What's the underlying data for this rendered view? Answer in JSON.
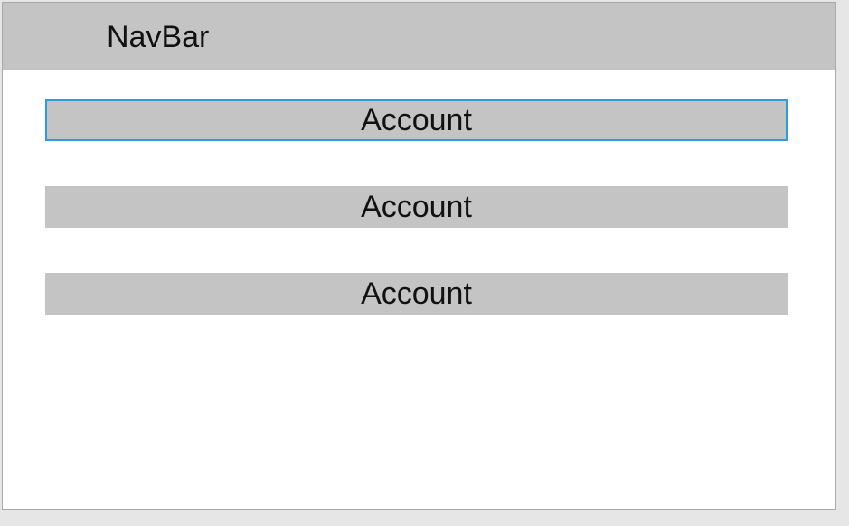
{
  "navbar": {
    "title": "NavBar"
  },
  "list": {
    "items": [
      {
        "label": "Account",
        "selected": true
      },
      {
        "label": "Account",
        "selected": false
      },
      {
        "label": "Account",
        "selected": false
      }
    ]
  },
  "colors": {
    "background": "#e6e6e6",
    "panel": "#ffffff",
    "navbar_bg": "#c4c4c4",
    "button_bg": "#c4c4c4",
    "selection_border": "#2b9bdc"
  }
}
